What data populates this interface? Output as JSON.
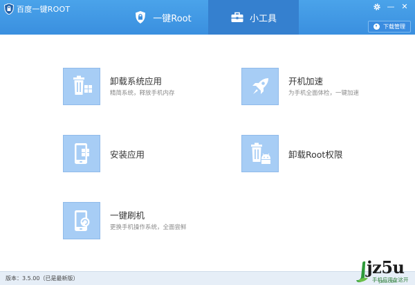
{
  "window": {
    "title": "百度一键ROOT",
    "controls": {
      "settings_icon": "gear-icon",
      "minimize_label": "—",
      "close_label": "✕"
    }
  },
  "tabs": [
    {
      "label": "一键Root",
      "icon": "shield-lock-icon",
      "active": false
    },
    {
      "label": "小工具",
      "icon": "toolbox-icon",
      "active": true
    }
  ],
  "download_button": {
    "label": "下载管理",
    "icon": "download-icon"
  },
  "tools": [
    {
      "title": "卸载系统应用",
      "desc": "精简系统，释放手机内存",
      "icon": "trash-apps-icon"
    },
    {
      "title": "开机加速",
      "desc": "为手机全面体检，一键加速",
      "icon": "rocket-icon"
    },
    {
      "title": "安装应用",
      "desc": "",
      "icon": "phone-apps-icon"
    },
    {
      "title": "卸载Root权限",
      "desc": "",
      "icon": "trash-android-icon"
    },
    {
      "title": "一键刷机",
      "desc": "更换手机操作系统，全面尝鲜",
      "icon": "phone-flash-icon"
    }
  ],
  "footer": {
    "version": "版本：3.5.00（已是最新版）"
  },
  "watermark": {
    "logo": "jz5u",
    "caption": "手机应用在这开",
    "url": "JZ5U.COM"
  },
  "colors": {
    "header": "#3a8fdf",
    "active_tab": "#3580cf",
    "tool_icon_bg": "#a7cdf5",
    "footer_bg": "#e6eef7"
  }
}
